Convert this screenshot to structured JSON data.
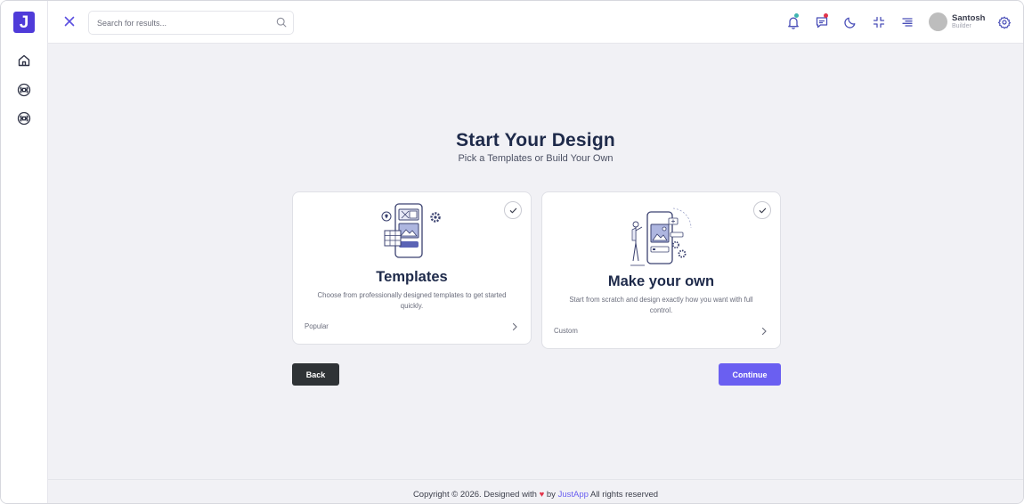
{
  "app": {
    "logo_letter": "J"
  },
  "sidebar": {
    "items": [
      {
        "icon": "home-icon"
      },
      {
        "icon": "command-icon"
      },
      {
        "icon": "command-icon"
      }
    ]
  },
  "header": {
    "search": {
      "placeholder": "Search for results..."
    },
    "user": {
      "name": "Santosh",
      "role": "Builder"
    }
  },
  "main": {
    "title": "Start Your Design",
    "subtitle": "Pick a Templates or Build Your Own",
    "cards": [
      {
        "title": "Templates",
        "description": "Choose from professionally designed templates to get started quickly.",
        "tag": "Popular"
      },
      {
        "title": "Make your own",
        "description": "Start from scratch and design exactly how you want with full control.",
        "tag": "Custom"
      }
    ],
    "back_label": "Back",
    "continue_label": "Continue"
  },
  "footer": {
    "prefix": "Copyright © 2026. Designed with",
    "heart": "♥",
    "by": "by",
    "brand": "JustApp",
    "suffix": "All rights reserved"
  },
  "colors": {
    "accent": "#6a5ff1",
    "logo": "#4f3bd9",
    "dark_button": "#2f3336",
    "heading": "#1e2a4a",
    "notification_dot": "#3fb4b0",
    "message_dot": "#e2344a"
  }
}
